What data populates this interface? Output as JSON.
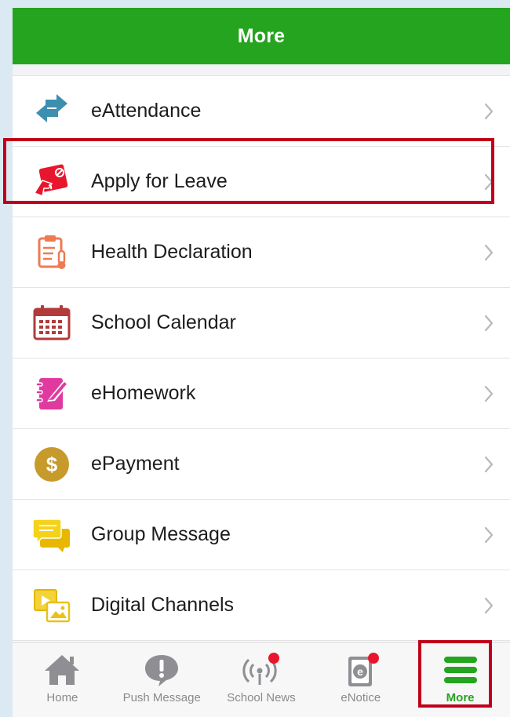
{
  "header": {
    "title": "More"
  },
  "menu": {
    "items": [
      {
        "label": "eAttendance",
        "icon": "arrows-exchange-icon"
      },
      {
        "label": "Apply for Leave",
        "icon": "leave-slip-icon"
      },
      {
        "label": "Health Declaration",
        "icon": "clipboard-thermometer-icon"
      },
      {
        "label": "School Calendar",
        "icon": "calendar-icon"
      },
      {
        "label": "eHomework",
        "icon": "notebook-pen-icon"
      },
      {
        "label": "ePayment",
        "icon": "dollar-coin-icon"
      },
      {
        "label": "Group Message",
        "icon": "chat-bubbles-icon"
      },
      {
        "label": "Digital Channels",
        "icon": "video-channel-icon"
      }
    ]
  },
  "tabbar": {
    "tabs": [
      {
        "label": "Home",
        "icon": "home-icon"
      },
      {
        "label": "Push Message",
        "icon": "alert-bubble-icon"
      },
      {
        "label": "School News",
        "icon": "broadcast-icon"
      },
      {
        "label": "eNotice",
        "icon": "enotice-icon"
      },
      {
        "label": "More",
        "icon": "hamburger-menu-icon",
        "active": true
      }
    ]
  },
  "colors": {
    "brand_green": "#25a41f",
    "highlight_red": "#c0001a",
    "badge_red": "#e8162d"
  }
}
